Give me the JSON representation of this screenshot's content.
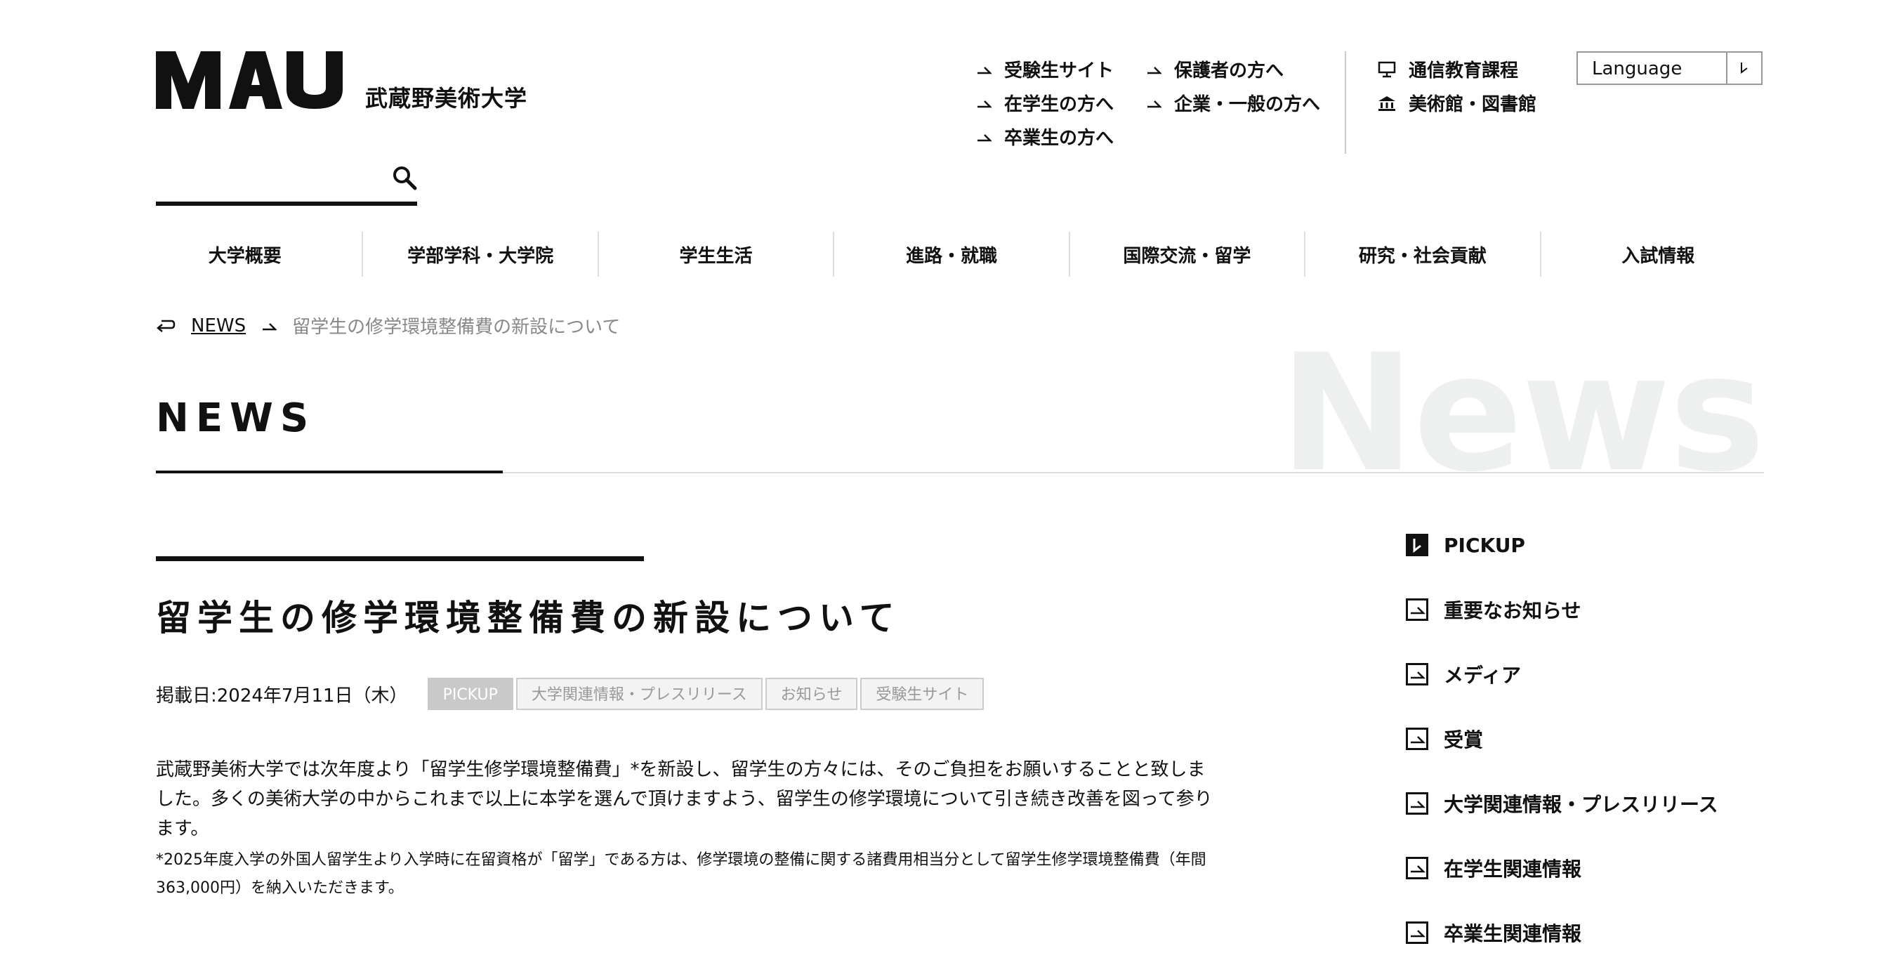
{
  "logo": {
    "mark_text": "MAU",
    "name": "武蔵野美術大学"
  },
  "search": {
    "placeholder": ""
  },
  "utility_links": {
    "col1": [
      "受験生サイト",
      "在学生の方へ",
      "卒業生の方へ"
    ],
    "col2": [
      "保護者の方へ",
      "企業・一般の方へ"
    ],
    "col3": [
      {
        "label": "通信教育課程",
        "icon": "monitor-icon"
      },
      {
        "label": "美術館・図書館",
        "icon": "museum-icon"
      }
    ]
  },
  "language": {
    "label": "Language"
  },
  "global_nav": [
    "大学概要",
    "学部学科・大学院",
    "学生生活",
    "進路・就職",
    "国際交流・留学",
    "研究・社会貢献",
    "入試情報"
  ],
  "breadcrumb": {
    "link": "NEWS",
    "current": "留学生の修学環境整備費の新設について"
  },
  "section": {
    "title": "NEWS",
    "bg_word": "News"
  },
  "article": {
    "title": "留学生の修学環境整備費の新設について",
    "date": "掲載日:2024年7月11日（木）",
    "tags": [
      "PICKUP",
      "大学関連情報・プレスリリース",
      "お知らせ",
      "受験生サイト"
    ],
    "body": "武蔵野美術大学では次年度より「留学生修学環境整備費」*を新設し、留学生の方々には、そのご負担をお願いすることと致しました。多くの美術大学の中からこれまで以上に本学を選んで頂けますよう、留学生の修学環境について引き続き改善を図って参ります。",
    "note": "*2025年度入学の外国人留学生より入学時に在留資格が「留学」である方は、修学環境の整備に関する諸費用相当分として留学生修学環境整備費（年間363,000円）を納入いただきます。"
  },
  "sidebar": {
    "items": [
      {
        "label": "PICKUP",
        "active": true
      },
      {
        "label": "重要なお知らせ",
        "active": false
      },
      {
        "label": "メディア",
        "active": false
      },
      {
        "label": "受賞",
        "active": false
      },
      {
        "label": "大学関連情報・プレスリリース",
        "active": false
      },
      {
        "label": "在学生関連情報",
        "active": false
      },
      {
        "label": "卒業生関連情報",
        "active": false
      }
    ]
  }
}
